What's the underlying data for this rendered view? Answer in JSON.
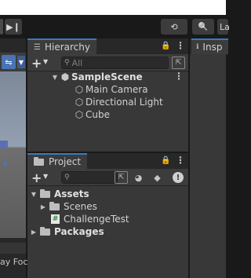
{
  "toolbar": {
    "step_icon": "▶❙",
    "history_icon": "⟲",
    "search_icon": "🔍",
    "layers_label": "La"
  },
  "scene": {
    "transform_icon": "⇋",
    "dropdown_icon": "▼",
    "gizmo_axis": "z",
    "bottom_label": "ay Foc"
  },
  "hierarchy": {
    "tab_label": "Hierarchy",
    "tab_icon": "☰",
    "lock_icon": "🔒",
    "menu_icon": "⋮",
    "add_label": "+",
    "add_caret": "▼",
    "search_placeholder": "All",
    "scene_name": "SampleScene",
    "items": [
      {
        "label": "Main Camera"
      },
      {
        "label": "Directional Light"
      },
      {
        "label": "Cube"
      }
    ]
  },
  "inspector": {
    "tab_label": "Insp",
    "tab_icon": "ℹ"
  },
  "project": {
    "tab_label": "Project",
    "lock_icon": "🔒",
    "menu_icon": "⋮",
    "add_label": "+",
    "add_caret": "▼",
    "search_placeholder": "",
    "assets_label": "Assets",
    "assets_children": [
      {
        "label": "Scenes",
        "type": "folder"
      },
      {
        "label": "ChallengeTest",
        "type": "script"
      }
    ],
    "packages_label": "Packages"
  },
  "colors": {
    "accent": "#3a79bb",
    "panel_bg": "#383838",
    "tab_bg": "#282828",
    "scene_blue": "#4a74b3"
  }
}
